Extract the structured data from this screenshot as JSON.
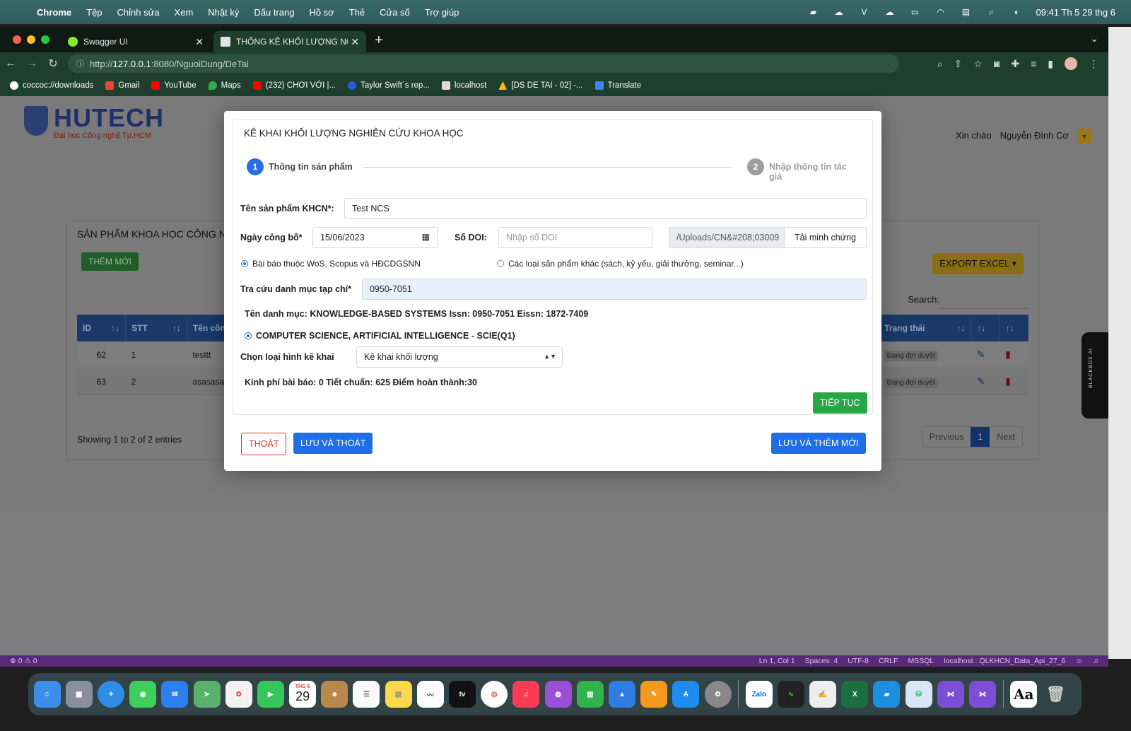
{
  "menubar": {
    "app": "Chrome",
    "items": [
      "Tệp",
      "Chỉnh sửa",
      "Xem",
      "Nhật ký",
      "Dấu trang",
      "Hồ sơ",
      "Thẻ",
      "Cửa sổ",
      "Trợ giúp"
    ],
    "clock": "09:41 Th 5 29 thg 6"
  },
  "tabs": [
    {
      "title": "Swagger UI"
    },
    {
      "title": "THỐNG KÊ KHỐI LƯỢNG NCKH"
    }
  ],
  "url": {
    "prefix": "http://",
    "host": "127.0.0.1",
    "path": ":8080/NguoiDung/DeTai"
  },
  "bookmarks": [
    "coccoc://downloads",
    "Gmail",
    "YouTube",
    "Maps",
    "(232) CHƠI VỚI |...",
    "Taylor Swift´s rep...",
    "localhost",
    "[DS DE TAI - 02] -...",
    "Translate"
  ],
  "site": {
    "logo_name": "HUTECH",
    "logo_sub": "Đại học Công nghệ Tp.HCM",
    "greeting": "Xin chào",
    "user": "Nguyễn Đình Cơ"
  },
  "card": {
    "title": "SẢN PHẨM KHOA HỌC CÔNG NG",
    "add_button": "THÊM MỚI",
    "export_button": "EXPORT EXCEL",
    "search_label": "Search:",
    "headers": [
      "ID",
      "STT",
      "Tên côn",
      "Trạng thái"
    ],
    "rows": [
      {
        "id": "62",
        "stt": "1",
        "name": "testtt",
        "status": "Đang đợi duyệt"
      },
      {
        "id": "63",
        "stt": "2",
        "name": "asasasa",
        "status": "Đang đợi duyệt"
      }
    ],
    "showing": "Showing 1 to 2 of 2 entries",
    "pager": {
      "prev": "Previous",
      "page": "1",
      "next": "Next"
    }
  },
  "modal": {
    "title": "KÊ KHAI KHỐI LƯỢNG NGHIÊN CỨU KHOA HỌC",
    "step1": {
      "num": "1",
      "label": "Thông tin sản phẩm"
    },
    "step2": {
      "num": "2",
      "label": "Nhập thông tin tác giả"
    },
    "product_label": "Tên sản phẩm KHCN*:",
    "product_value": "Test NCS",
    "date_label": "Ngày công bố*",
    "date_value": "15/06/2023",
    "doi_label": "Số DOI:",
    "doi_placeholder": "Nhập số DOI",
    "upload_path": "/Uploads/CN&#208;03009",
    "upload_button": "Tải minh chứng",
    "radio1": "Bài báo thuộc WoS, Scopus và HĐCDGSNN",
    "radio2": "Các loại sản phẩm khác (sách, kỷ yếu, giải thưởng, seminar...)",
    "journal_label": "Tra cứu danh mục tạp chí*",
    "journal_value": "0950-7051",
    "catalog_info": "Tên danh mục: KNOWLEDGE-BASED SYSTEMS Issn: 0950-7051 Eissn: 1872-7409",
    "category_option": "COMPUTER SCIENCE, ARTIFICIAL INTELLIGENCE - SCIE(Q1)",
    "type_label": "Chọn loại hình kê khai",
    "type_value": "Kê khai khối lượng",
    "summary": "Kinh phí bài báo: 0 Tiết chuẩn: 625 Điểm hoàn thành:30",
    "continue_button": "TIẾP TỤC",
    "exit_button": "THOÁT",
    "save_exit_button": "LƯU VÀ THOÁT",
    "save_new_button": "LƯU VÀ THÊM MỚI"
  },
  "blackbox_label": "BLACKBOX AI",
  "statusbar": {
    "left": "⊗ 0 ⚠ 0",
    "items": [
      "Ln 1, Col 1",
      "Spaces: 4",
      "UTF-8",
      "CRLF",
      "MSSQL",
      "localhost : QLKHCN_Data_Api_27_6"
    ]
  },
  "dock": {
    "calendar_month": "THG 6",
    "calendar_day": "29",
    "zalo": "Zalo",
    "dictionary": "Aa"
  },
  "colors": {
    "accent": "#1e6fe6",
    "success": "#28a745",
    "danger": "#e0342b"
  }
}
